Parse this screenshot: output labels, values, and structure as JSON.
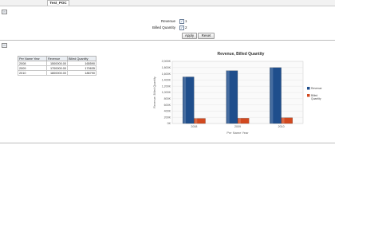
{
  "tab": {
    "label": "Test_POC"
  },
  "prompts": {
    "items": [
      {
        "label": "Revenue",
        "checked": true,
        "value": "1"
      },
      {
        "label": "Billed Quantity",
        "checked": true,
        "value": "2"
      }
    ],
    "apply_label": "Apply",
    "reset_label": "Reset"
  },
  "table": {
    "headers": [
      "Per Name Year",
      "Revenue",
      "Billed Quantity"
    ],
    "rows": [
      [
        "2008",
        "1500000.00",
        "165590"
      ],
      [
        "2009",
        "1700000.00",
        "170635"
      ],
      [
        "2010",
        "1800000.00",
        "186790"
      ]
    ]
  },
  "chart_data": {
    "type": "bar",
    "title": "Revenue, Billed Quantity",
    "xlabel": "Per Name Year",
    "ylabel": "Revenue, Billed Quantity",
    "categories": [
      "2008",
      "2009",
      "2010"
    ],
    "series": [
      {
        "name": "Revenue",
        "color": "#1f4e8c",
        "values": [
          1500000,
          1700000,
          1800000
        ]
      },
      {
        "name": "Billed Quantity",
        "color": "#d2491f",
        "values": [
          165590,
          170635,
          186790
        ]
      }
    ],
    "ylim": [
      0,
      2000000
    ],
    "yticks": [
      "0K",
      "200K",
      "400K",
      "600K",
      "800K",
      "1,000K",
      "1,200K",
      "1,400K",
      "1,600K",
      "1,800K",
      "2,000K"
    ],
    "grid": true,
    "legend": "right"
  }
}
